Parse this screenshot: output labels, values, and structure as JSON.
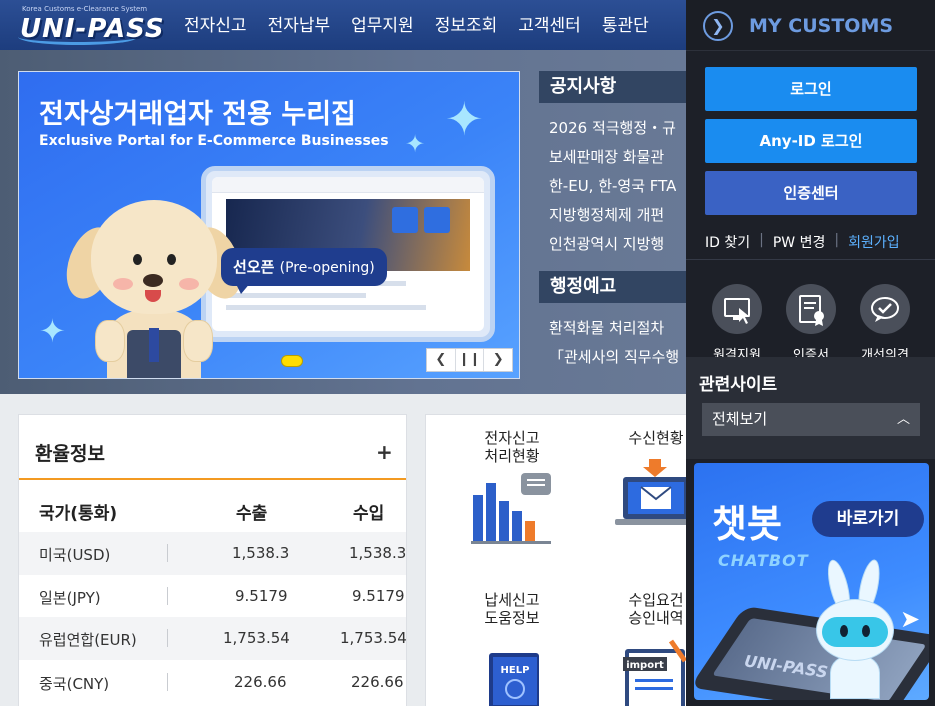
{
  "header": {
    "logo_small": "Korea Customs e-Clearance System",
    "logo_text": "UNI-PASS",
    "nav": [
      "전자신고",
      "전자납부",
      "업무지원",
      "정보조회",
      "고객센터",
      "통관단"
    ]
  },
  "banner": {
    "title": "전자상거래업자 전용 누리집",
    "subtitle": "Exclusive Portal for E-Commerce Businesses",
    "bubble_ko": "선오픈",
    "bubble_en": "(Pre-opening)",
    "ctrl_prev": "❮",
    "ctrl_pause": "❙❙",
    "ctrl_next": "❯"
  },
  "notices": {
    "title": "공지사항",
    "items": [
      "2026 적극행정・규",
      "보세판매장 화물관",
      "한-EU, 한-영국 FTA",
      "지방행정체제 개편",
      "인천광역시 지방행"
    ]
  },
  "admin_notice": {
    "title": "행정예고",
    "items": [
      "환적화물 처리절차",
      "「관세사의 직무수행"
    ]
  },
  "exchange": {
    "title": "환율정보",
    "plus": "+",
    "headers": {
      "country": "국가(통화)",
      "export": "수출",
      "import": "수입"
    },
    "rows": [
      {
        "country": "미국(USD)",
        "export": "1,538.3",
        "import": "1,538.3"
      },
      {
        "country": "일본(JPY)",
        "export": "9.5179",
        "import": "9.5179"
      },
      {
        "country": "유럽연합(EUR)",
        "export": "1,753.54",
        "import": "1,753.54"
      },
      {
        "country": "중국(CNY)",
        "export": "226.66",
        "import": "226.66"
      }
    ]
  },
  "services": [
    {
      "line1": "전자신고",
      "line2": "처리현황",
      "icon": "bar-chart-icon"
    },
    {
      "line1": "수신현황",
      "line2": "",
      "icon": "mail-laptop-icon"
    },
    {
      "line1": "납세신고",
      "line2": "도움정보",
      "icon": "help-book-icon"
    },
    {
      "line1": "수입요건",
      "line2": "승인내역",
      "icon": "import-document-icon"
    }
  ],
  "services_help_text": "HELP",
  "services_import_text": "import",
  "sidebar": {
    "title": "MY CUSTOMS",
    "login": "로그인",
    "anyid_login": "Any-ID 로그인",
    "cert_center": "인증센터",
    "find_id": "ID 찾기",
    "change_pw": "PW 변경",
    "join": "회원가입",
    "quick_menu": [
      {
        "label": "원격지원",
        "icon": "remote-support-icon"
      },
      {
        "label": "인증서",
        "icon": "certificate-icon"
      },
      {
        "label": "개선의견",
        "icon": "feedback-icon"
      }
    ],
    "related_title": "관련사이트",
    "related_select": "전체보기"
  },
  "chatbot": {
    "title": "챗봇",
    "subtitle": "CHATBOT",
    "go": "바로가기",
    "phone_text": "UNI-PASS"
  },
  "colors": {
    "header_bg": "#1d3d7e",
    "accent_orange": "#f39a21",
    "sidebar_bg": "#1d2028",
    "login_blue": "#1a8cf0",
    "cert_indigo": "#3a62c4",
    "chatbot_blue": "#3e8cff"
  }
}
